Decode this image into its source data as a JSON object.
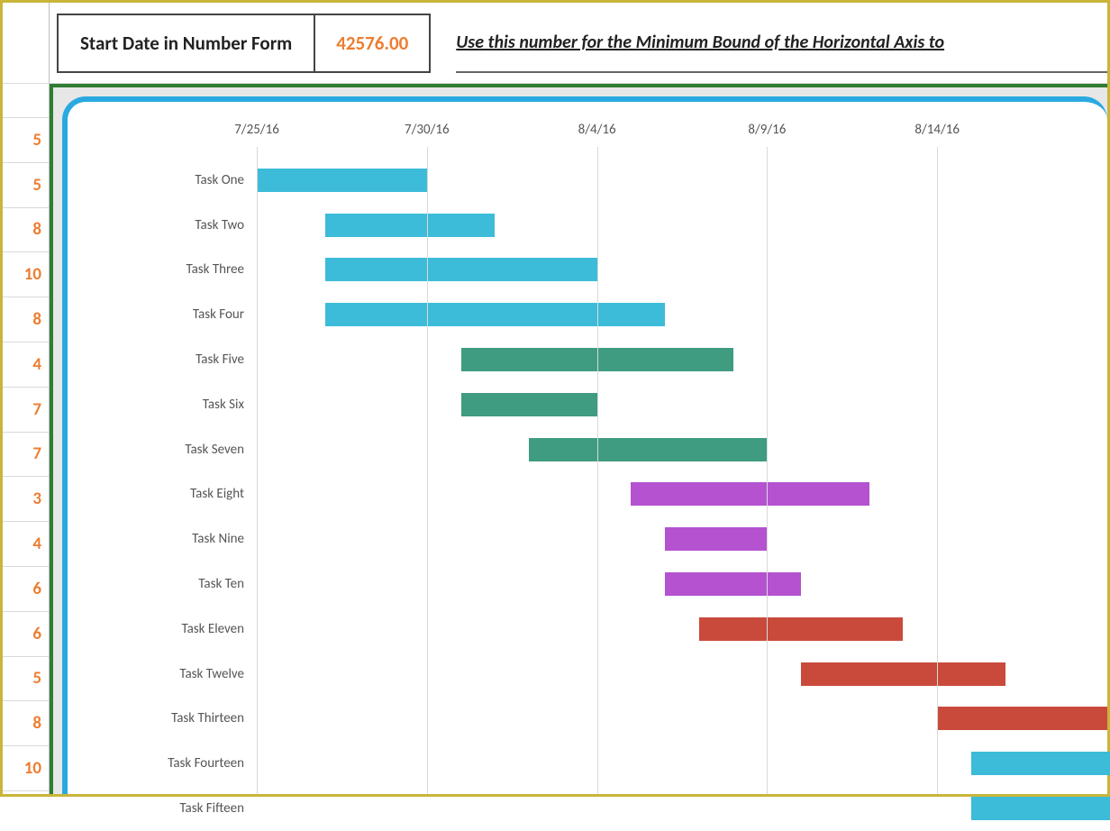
{
  "header": {
    "label": "Start Date in Number Form",
    "value": "42576.00",
    "hint": "Use this number for the Minimum Bound of the Horizontal Axis to"
  },
  "row_numbers": [
    "5",
    "5",
    "8",
    "10",
    "8",
    "4",
    "7",
    "7",
    "3",
    "4",
    "6",
    "6",
    "5",
    "8",
    "10"
  ],
  "colors": {
    "blue": "#3cbcd8",
    "green": "#3f9c80",
    "purple": "#b452d0",
    "red": "#c94a3b"
  },
  "chart_data": {
    "type": "bar",
    "orientation": "horizontal",
    "xlabel": "",
    "ylabel": "",
    "x_ticks": [
      {
        "label": "7/25/16",
        "serial": 42576
      },
      {
        "label": "7/30/16",
        "serial": 42581
      },
      {
        "label": "8/4/16",
        "serial": 42586
      },
      {
        "label": "8/9/16",
        "serial": 42591
      },
      {
        "label": "8/14/16",
        "serial": 42596
      }
    ],
    "x_min_serial": 42576,
    "x_visible_span_days": 25,
    "tasks": [
      {
        "name": "Task One",
        "start_serial": 42576,
        "duration": 5,
        "color": "blue"
      },
      {
        "name": "Task Two",
        "start_serial": 42578,
        "duration": 5,
        "color": "blue"
      },
      {
        "name": "Task Three",
        "start_serial": 42578,
        "duration": 8,
        "color": "blue"
      },
      {
        "name": "Task Four",
        "start_serial": 42578,
        "duration": 10,
        "color": "blue"
      },
      {
        "name": "Task Five",
        "start_serial": 42582,
        "duration": 8,
        "color": "green"
      },
      {
        "name": "Task Six",
        "start_serial": 42582,
        "duration": 4,
        "color": "green"
      },
      {
        "name": "Task Seven",
        "start_serial": 42584,
        "duration": 7,
        "color": "green"
      },
      {
        "name": "Task Eight",
        "start_serial": 42587,
        "duration": 7,
        "color": "purple"
      },
      {
        "name": "Task Nine",
        "start_serial": 42588,
        "duration": 3,
        "color": "purple"
      },
      {
        "name": "Task Ten",
        "start_serial": 42588,
        "duration": 4,
        "color": "purple"
      },
      {
        "name": "Task Eleven",
        "start_serial": 42589,
        "duration": 6,
        "color": "red"
      },
      {
        "name": "Task Twelve",
        "start_serial": 42592,
        "duration": 6,
        "color": "red"
      },
      {
        "name": "Task Thirteen",
        "start_serial": 42596,
        "duration": 5,
        "color": "red"
      },
      {
        "name": "Task Fourteen",
        "start_serial": 42597,
        "duration": 8,
        "color": "blue"
      },
      {
        "name": "Task Fifteen",
        "start_serial": 42597,
        "duration": 10,
        "color": "blue"
      }
    ]
  }
}
